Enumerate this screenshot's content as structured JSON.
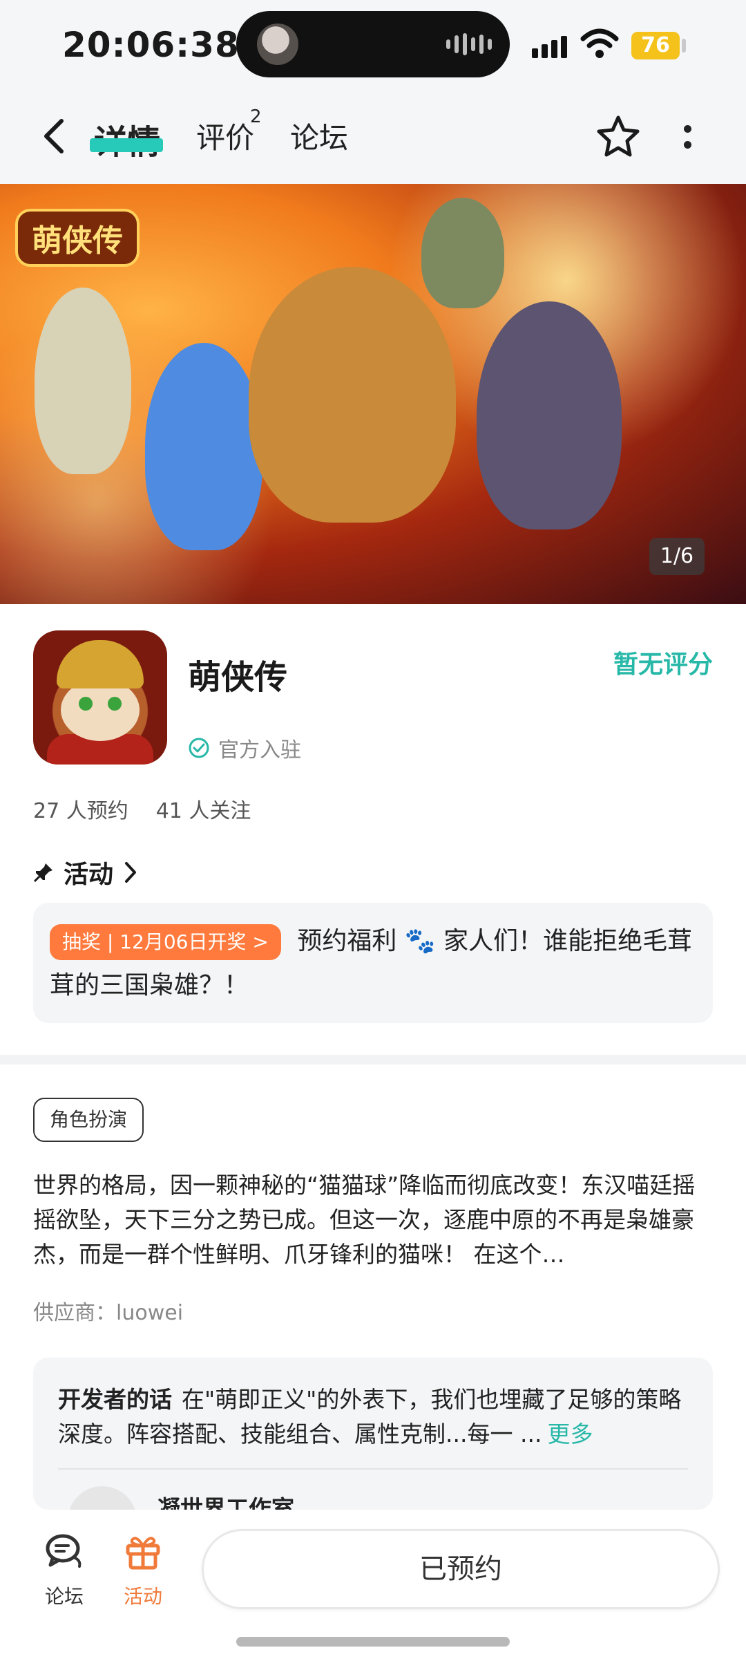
{
  "status_bar": {
    "time": "20:06:38",
    "battery": "76"
  },
  "nav": {
    "tabs": [
      {
        "label": "详情",
        "active": true
      },
      {
        "label": "评价",
        "badge": "2"
      },
      {
        "label": "论坛"
      }
    ]
  },
  "banner": {
    "logo_text": "萌侠传",
    "counter": "1/6"
  },
  "game": {
    "title": "萌侠传",
    "rating_text": "暂无评分",
    "official_label": "官方入驻",
    "reservations": "27 人预约",
    "followers": "41 人关注"
  },
  "activity": {
    "heading": "活动",
    "pill": "抽奖 | 12月06日开奖 >",
    "text_before": "预约福利",
    "paw": "🐾",
    "text_after": "家人们！谁能拒绝毛茸茸的三国枭雄？！"
  },
  "description": {
    "tag": "角色扮演",
    "text": "世界的格局，因一颗神秘的“猫猫球”降临而彻底改变！东汉喵廷摇摇欲坠，天下三分之势已成。但这一次，逐鹿中原的不再是枭雄豪杰，而是一群个性鲜明、爪牙锋利的猫咪！ 在这个…",
    "supplier": "供应商：luowei"
  },
  "developer": {
    "label": "开发者的话",
    "text": "在\"萌即正义\"的外表下，我们也埋藏了足够的策略深度。阵容搭配、技能组合、属性克制...每一 ...",
    "more": "更多",
    "studio": "凝世界工作室"
  },
  "bottom_bar": {
    "forum_label": "论坛",
    "activity_label": "活动",
    "reserve_label": "已预约"
  },
  "colors": {
    "accent": "#27b8a8",
    "orange": "#f07a3a",
    "tag_pill": "#ff7a3c"
  }
}
